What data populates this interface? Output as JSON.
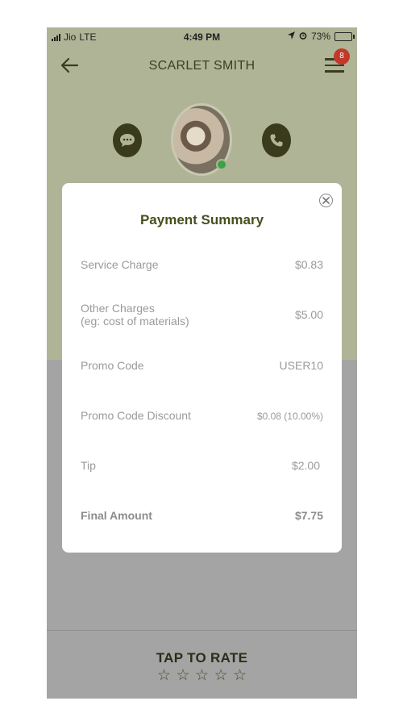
{
  "status_bar": {
    "carrier": "Jio",
    "network": "LTE",
    "time": "4:49 PM",
    "battery": "73%"
  },
  "header": {
    "title": "SCARLET SMITH",
    "notification_count": "8"
  },
  "modal": {
    "title": "Payment Summary",
    "rows": [
      {
        "label": "Service Charge",
        "label2": "",
        "value": "$0.83"
      },
      {
        "label": "Other Charges",
        "label2": "(eg: cost of materials)",
        "value": "$5.00"
      },
      {
        "label": "Promo Code",
        "label2": "",
        "value": "USER10"
      },
      {
        "label": "Promo Code Discount",
        "label2": "",
        "value": "$0.08 (10.00%)"
      },
      {
        "label": "Tip",
        "label2": "",
        "value": "$2.00"
      },
      {
        "label": "Final Amount",
        "label2": "",
        "value": "$7.75"
      }
    ]
  },
  "footer": {
    "rate_label": "TAP TO RATE",
    "star_glyph": "☆",
    "rating": 0,
    "max_rating": 5
  },
  "colors": {
    "header_bg": "#b0b497",
    "overlay_bg": "#a4a4a4",
    "accent": "#4a4e1e",
    "badge": "#c0392b",
    "online": "#3aa346"
  },
  "icons": [
    "back-arrow-icon",
    "menu-icon",
    "chat-icon",
    "phone-icon",
    "close-icon",
    "star-icon"
  ]
}
